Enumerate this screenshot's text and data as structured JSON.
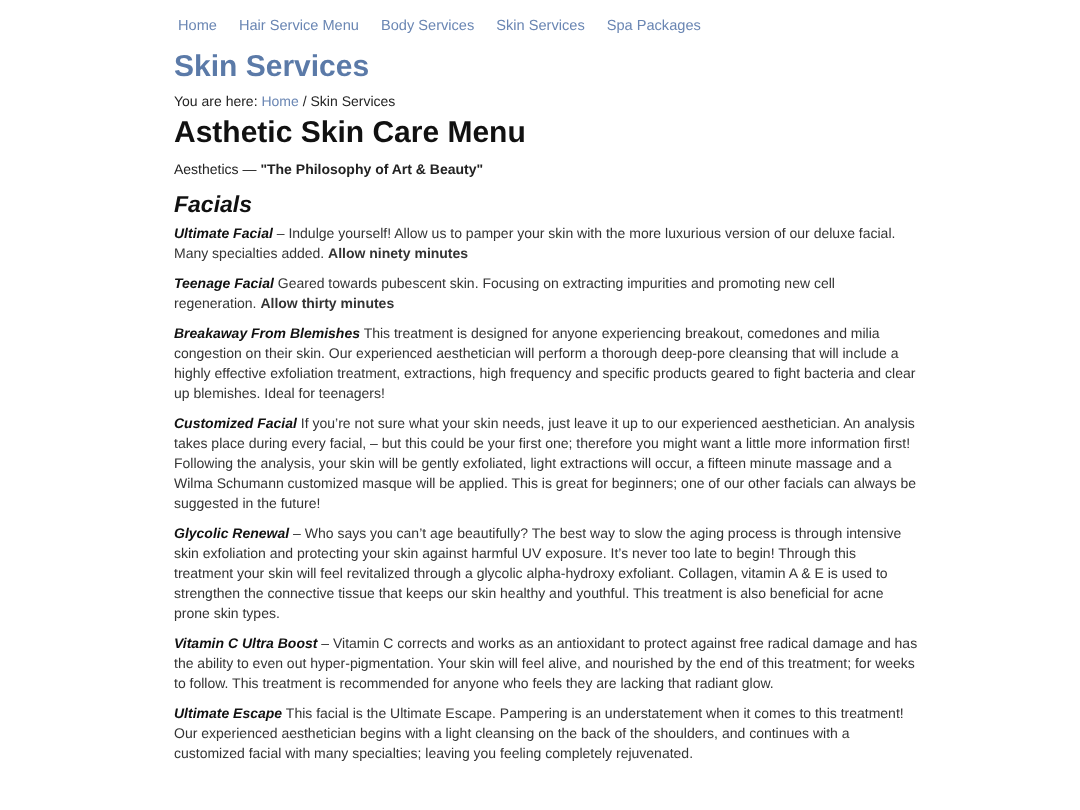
{
  "nav": {
    "items": [
      {
        "label": "Home"
      },
      {
        "label": "Hair Service Menu"
      },
      {
        "label": "Body Services"
      },
      {
        "label": "Skin Services"
      },
      {
        "label": "Spa Packages"
      }
    ]
  },
  "page_title": "Skin Services",
  "breadcrumb": {
    "prefix": "You are here:",
    "link": "Home",
    "rest": "/ Skin Services"
  },
  "heading": "Asthetic Skin Care Menu",
  "tagline": "Aesthetics — **\"The Philosophy of Art & Beauty\"**",
  "section_title": "Facials",
  "entries": [
    {
      "title": "Ultimate Facial",
      "text": "– Indulge yourself! Allow us to pamper your skin with the more luxurious version of our deluxe facial. Many specialties added. **Allow ninety minutes**"
    },
    {
      "title": "Teenage Facial",
      "text": "Geared towards pubescent skin. Focusing on extracting impurities and promoting new cell regeneration. **Allow thirty minutes**"
    },
    {
      "title": "Breakaway From Blemishes",
      "text": "This treatment is designed for anyone experiencing breakout, comedones and milia congestion on their skin. Our experienced aesthetician will perform a thorough deep-pore cleansing that will include a highly effective exfoliation treatment, extractions, high frequency and specific products geared to fight bacteria and clear up blemishes. Ideal for teenagers!"
    },
    {
      "title": "Customized Facial",
      "text": "If you’re not sure what your skin needs, just leave it up to our experienced aesthetician. An analysis takes place during every facial, – but this could be your first one; therefore you might want a little more information first! Following the analysis, your skin will be gently exfoliated, light extractions will occur, a fifteen minute massage and a Wilma Schumann customized masque will be applied. This is great for beginners; one of our other facials can always be suggested in the future!"
    },
    {
      "title": "Glycolic Renewal",
      "text": "– Who says you can’t age beautifully? The best way to slow the aging process is through intensive skin exfoliation and protecting your skin against harmful UV exposure. It’s never too late to begin! Through this treatment your skin will feel revitalized through a glycolic alpha-hydroxy exfoliant. Collagen, vitamin A & E is used to strengthen the connective tissue that keeps our skin healthy and youthful. This treatment is also beneficial for acne prone skin types."
    },
    {
      "title": "Vitamin C Ultra Boost",
      "text": "– Vitamin C corrects and works as an antioxidant to protect against free radical damage and has the ability to even out hyper-pigmentation. Your skin will feel alive, and nourished by the end of this treatment; for weeks to follow. This treatment is recommended for anyone who feels they are lacking that radiant glow."
    },
    {
      "title": "Ultimate Escape",
      "text": "This facial is the Ultimate Escape. Pampering is an understatement when it comes to this treatment! Our experienced aesthetician begins with a light cleansing on the back of the shoulders, and continues with a customized facial with many specialties; leaving you feeling completely rejuvenated."
    }
  ]
}
